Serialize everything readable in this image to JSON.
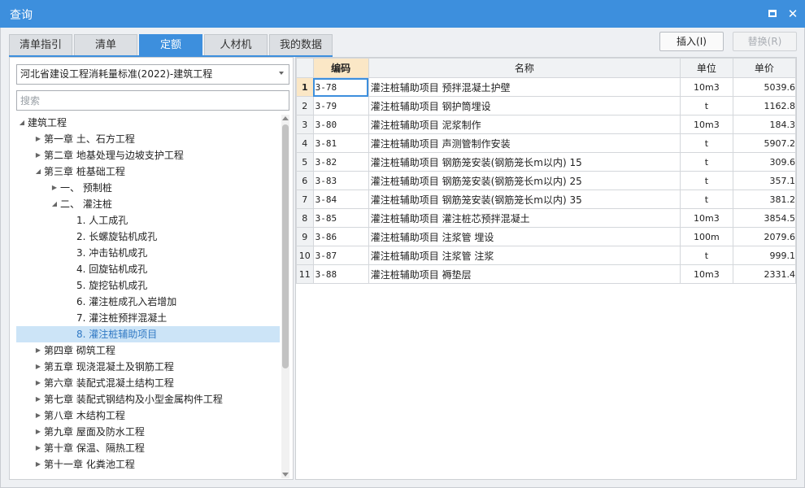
{
  "window": {
    "title": "查询",
    "maximize_glyph": "maximize-icon",
    "close_glyph": "✕"
  },
  "tabs": [
    {
      "label": "清单指引",
      "active": false
    },
    {
      "label": "清单",
      "active": false
    },
    {
      "label": "定额",
      "active": true
    },
    {
      "label": "人材机",
      "active": false
    },
    {
      "label": "我的数据",
      "active": false
    }
  ],
  "toolbar": {
    "insert_label": "插入(I)",
    "replace_label": "替换(R)"
  },
  "library_select": {
    "value": "河北省建设工程消耗量标准(2022)-建筑工程"
  },
  "search": {
    "placeholder": "搜索"
  },
  "tree": [
    {
      "level": 0,
      "label": "建筑工程",
      "state": "expanded"
    },
    {
      "level": 1,
      "label": "第一章 土、石方工程",
      "state": "collapsed"
    },
    {
      "level": 1,
      "label": "第二章 地基处理与边坡支护工程",
      "state": "collapsed"
    },
    {
      "level": 1,
      "label": "第三章 桩基础工程",
      "state": "expanded"
    },
    {
      "level": 2,
      "label": "一、 预制桩",
      "state": "collapsed"
    },
    {
      "level": 2,
      "label": "二、 灌注桩",
      "state": "expanded"
    },
    {
      "level": 3,
      "label": "1. 人工成孔",
      "state": "leaf"
    },
    {
      "level": 3,
      "label": "2. 长螺旋钻机成孔",
      "state": "leaf"
    },
    {
      "level": 3,
      "label": "3. 冲击钻机成孔",
      "state": "leaf"
    },
    {
      "level": 3,
      "label": "4. 回旋钻机成孔",
      "state": "leaf"
    },
    {
      "level": 3,
      "label": "5. 旋挖钻机成孔",
      "state": "leaf"
    },
    {
      "level": 3,
      "label": "6. 灌注桩成孔入岩增加",
      "state": "leaf"
    },
    {
      "level": 3,
      "label": "7. 灌注桩预拌混凝土",
      "state": "leaf"
    },
    {
      "level": 3,
      "label": "8. 灌注桩辅助项目",
      "state": "leaf",
      "selected": true
    },
    {
      "level": 1,
      "label": "第四章 砌筑工程",
      "state": "collapsed"
    },
    {
      "level": 1,
      "label": "第五章 现浇混凝土及钢筋工程",
      "state": "collapsed"
    },
    {
      "level": 1,
      "label": "第六章 装配式混凝土结构工程",
      "state": "collapsed"
    },
    {
      "level": 1,
      "label": "第七章 装配式钢结构及小型金属构件工程",
      "state": "collapsed"
    },
    {
      "level": 1,
      "label": "第八章 木结构工程",
      "state": "collapsed"
    },
    {
      "level": 1,
      "label": "第九章 屋面及防水工程",
      "state": "collapsed"
    },
    {
      "level": 1,
      "label": "第十章 保温、隔热工程",
      "state": "collapsed"
    },
    {
      "level": 1,
      "label": "第十一章 化粪池工程",
      "state": "collapsed"
    }
  ],
  "table": {
    "columns": [
      "",
      "编码",
      "名称",
      "单位",
      "单价"
    ],
    "rows": [
      {
        "no": "1",
        "code": "3-78",
        "name": "灌注桩辅助项目 预拌混凝土护壁",
        "unit": "10m3",
        "price": "5039.6"
      },
      {
        "no": "2",
        "code": "3-79",
        "name": "灌注桩辅助项目 钢护筒埋设",
        "unit": "t",
        "price": "1162.8"
      },
      {
        "no": "3",
        "code": "3-80",
        "name": "灌注桩辅助项目 泥浆制作",
        "unit": "10m3",
        "price": "184.3"
      },
      {
        "no": "4",
        "code": "3-81",
        "name": "灌注桩辅助项目 声测管制作安装",
        "unit": "t",
        "price": "5907.2"
      },
      {
        "no": "5",
        "code": "3-82",
        "name": "灌注桩辅助项目 钢筋笼安装(钢筋笼长m以内) 15",
        "unit": "t",
        "price": "309.6"
      },
      {
        "no": "6",
        "code": "3-83",
        "name": "灌注桩辅助项目 钢筋笼安装(钢筋笼长m以内) 25",
        "unit": "t",
        "price": "357.1"
      },
      {
        "no": "7",
        "code": "3-84",
        "name": "灌注桩辅助项目 钢筋笼安装(钢筋笼长m以内) 35",
        "unit": "t",
        "price": "381.2"
      },
      {
        "no": "8",
        "code": "3-85",
        "name": "灌注桩辅助项目 灌注桩芯预拌混凝土",
        "unit": "10m3",
        "price": "3854.5"
      },
      {
        "no": "9",
        "code": "3-86",
        "name": "灌注桩辅助项目 注浆管 埋设",
        "unit": "100m",
        "price": "2079.6"
      },
      {
        "no": "10",
        "code": "3-87",
        "name": "灌注桩辅助项目 注浆管 注浆",
        "unit": "t",
        "price": "999.1"
      },
      {
        "no": "11",
        "code": "3-88",
        "name": "灌注桩辅助项目 褥垫层",
        "unit": "10m3",
        "price": "2331.4"
      }
    ]
  },
  "colors": {
    "accent": "#3d8fdd",
    "header_highlight": "#fbe7c6",
    "tree_selected": "#cce4f7"
  }
}
